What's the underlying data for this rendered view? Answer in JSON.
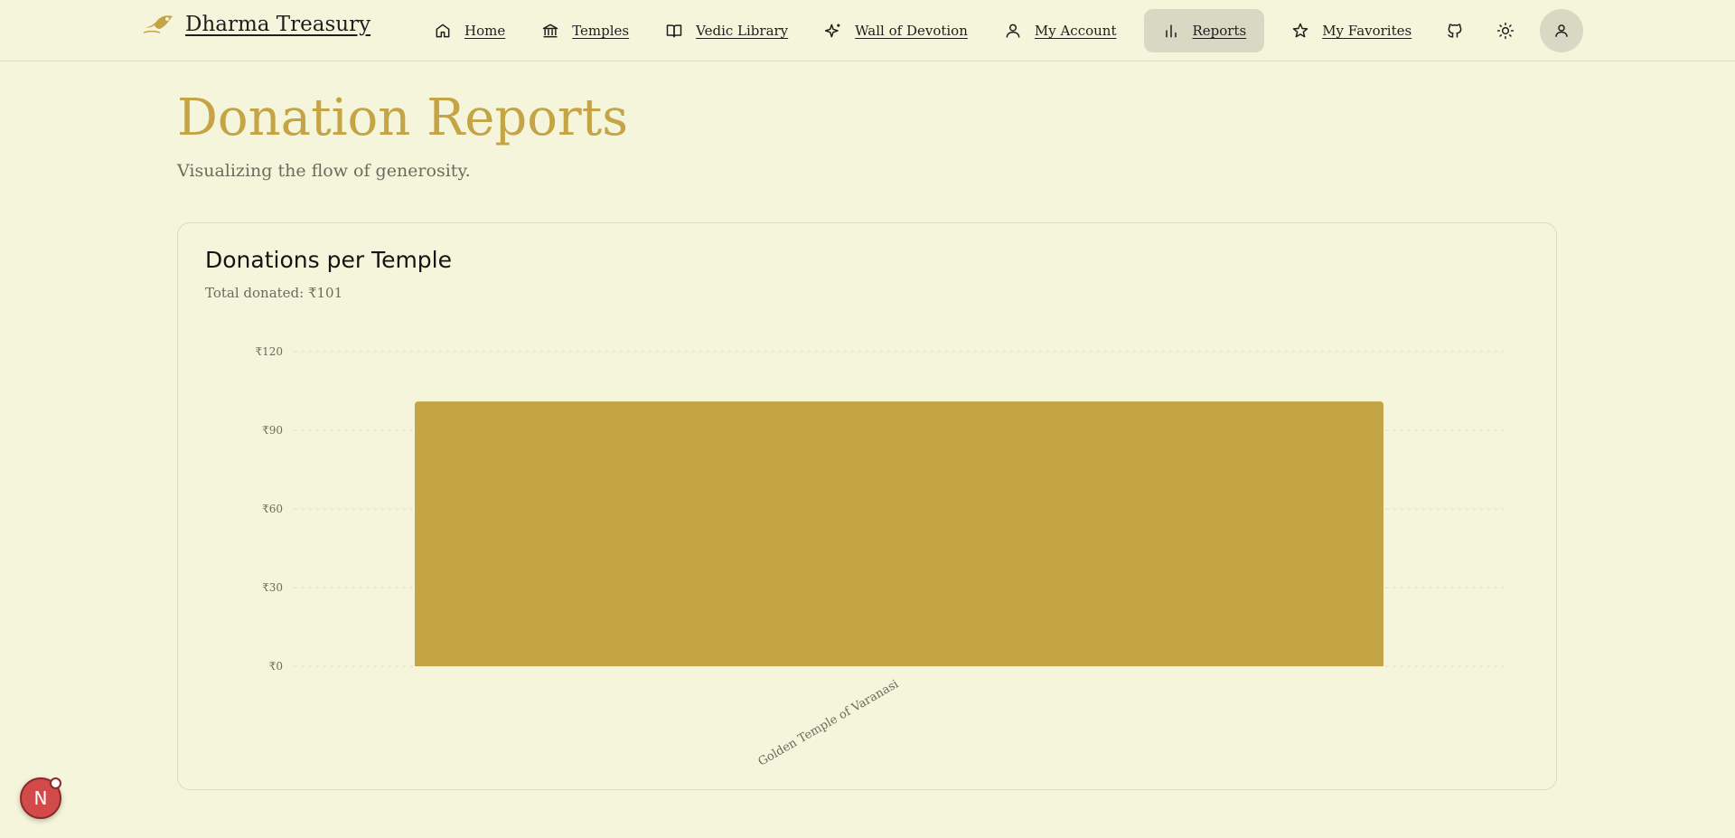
{
  "app": {
    "brand_name": "Dharma Treasury"
  },
  "nav": {
    "items": [
      {
        "label": "Home",
        "icon": "home-icon"
      },
      {
        "label": "Temples",
        "icon": "temple-icon"
      },
      {
        "label": "Vedic Library",
        "icon": "book-icon"
      },
      {
        "label": "Wall of Devotion",
        "icon": "sparkles-icon"
      },
      {
        "label": "My Account",
        "icon": "user-icon"
      },
      {
        "label": "Reports",
        "icon": "bar-chart-icon",
        "active": true
      },
      {
        "label": "My Favorites",
        "icon": "star-icon"
      }
    ],
    "actions": [
      "github-icon",
      "sun-icon",
      "user-avatar-icon"
    ]
  },
  "page": {
    "title": "Donation Reports",
    "subtitle": "Visualizing the flow of generosity."
  },
  "card": {
    "title": "Donations per Temple",
    "description": "Total donated: ₹101"
  },
  "chart_data": {
    "type": "bar",
    "categories": [
      "Golden Temple of Varanasi"
    ],
    "values": [
      101
    ],
    "ylim": [
      0,
      120
    ],
    "yticks": [
      0,
      30,
      60,
      90,
      120
    ],
    "ytick_labels": [
      "₹0",
      "₹30",
      "₹60",
      "₹90",
      "₹120"
    ],
    "grid": true,
    "bar_color": "#c4a444"
  },
  "badge": {
    "label": "N"
  },
  "colors": {
    "background": "#f5f5dc",
    "accent": "#c4a444",
    "active_nav": "#d9d8c3",
    "badge": "#d34a4a"
  }
}
